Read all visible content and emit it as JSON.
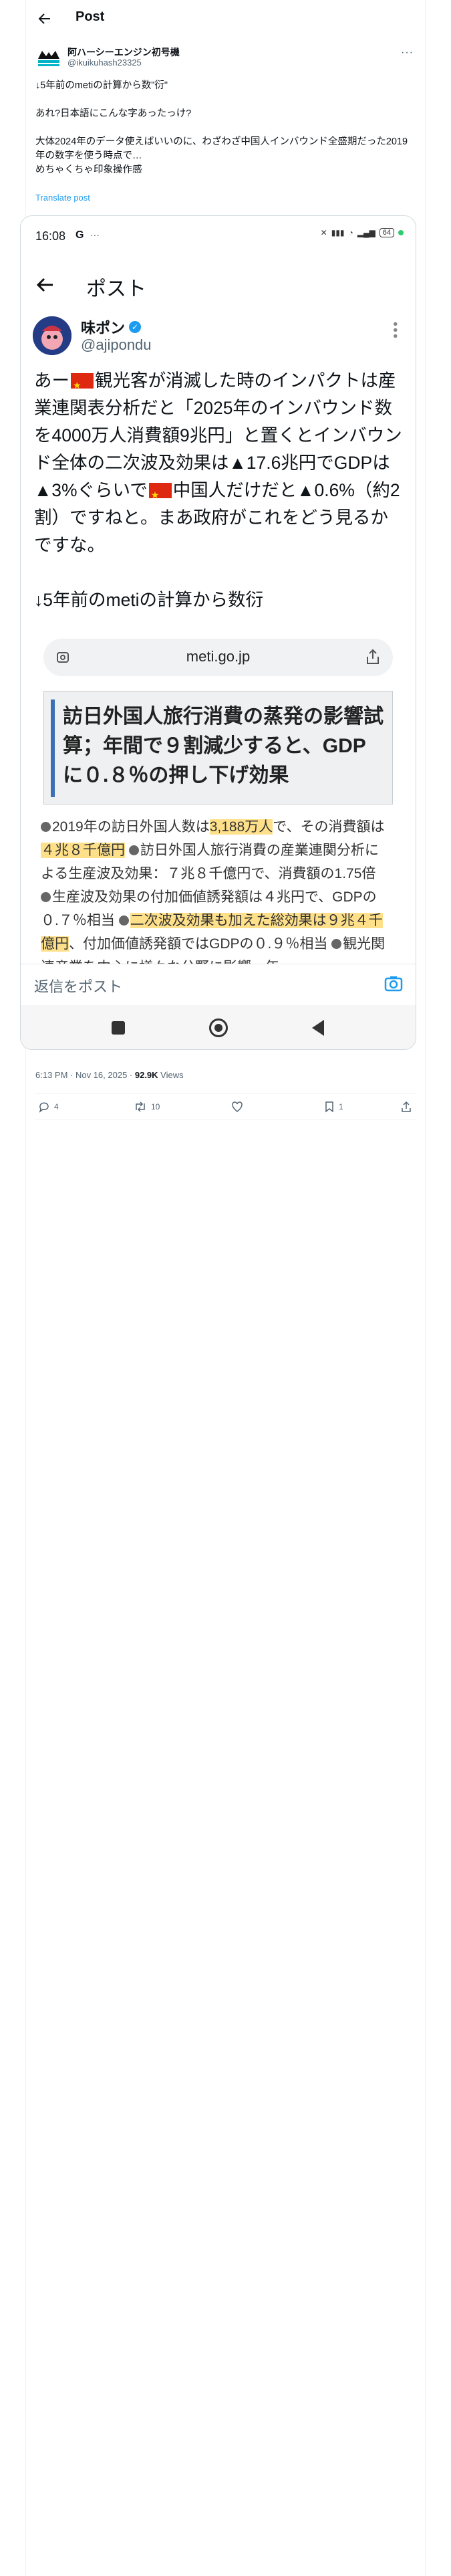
{
  "header": {
    "title": "Post"
  },
  "author": {
    "name": "阿ハーシーエンジン初号機",
    "handle": "@ikuikuhash23325"
  },
  "tweet": {
    "text": "↓5年前のmetiの計算から数\"衍\"\n\nあれ?日本語にこんな字あったっけ?\n\n大体2024年のデータ使えばいいのに、わざわざ中国人インバウンド全盛期だった2019年の数字を使う時点で…\nめちゃくちゃ印象操作感",
    "translate": "Translate post"
  },
  "embedded": {
    "status": {
      "time": "16:08",
      "g": "G",
      "dots": "···",
      "battery": "64"
    },
    "appbar_title": "ポスト",
    "author_name": "味ポン",
    "author_handle": "@ajipondu",
    "text_parts": {
      "p1": "あー",
      "p2": "観光客が消滅した時のインパクトは産業連関表分析だと「2025年のインバウンド数を4000万人消費額9兆円」と置くとインバウンド全体の二次波及効果は▲17.6兆円でGDPは▲3%ぐらいで",
      "p3": "中国人だけだと▲0.6%（約2割）ですねと。まあ政府がこれをどう見るかですな。",
      "p4": "↓5年前のmetiの計算から数衍"
    },
    "url": "meti.go.jp",
    "headline": "訪日外国人旅行消費の蒸発の影響試算；年間で９割減少すると、GDPに０.８％の押し下げ効果",
    "doc": {
      "s1": "2019年の訪日外国人数は",
      "h1": "3,188万人",
      "s2": "で、その消費額は",
      "h2": "４兆８千億円",
      "s3": "訪日外国人旅行消費の産業連関分析による生産波及効果：７兆８千億円で、消費額の1.75倍",
      "s4": "生産波及効果の付加価値誘発額は４兆円で、GDPの０.７％相当",
      "h3": "二次波及効果も加えた総効果は９兆４千億円",
      "s5": "、付加価値誘発額ではGDPの０.９％相当",
      "s6": "観光関連産業を中心に様々な分野に影響、年"
    },
    "reply_placeholder": "返信をポスト"
  },
  "meta": {
    "time": "6:13 PM · Nov 16, 2025 · ",
    "views": "92.9K",
    "views_label": " Views"
  },
  "actions": {
    "replies": "4",
    "reposts": "10",
    "likes": "",
    "bookmarks": "1"
  },
  "colors": {
    "accent": "#1d9bf0",
    "highlight": "#ffe08a",
    "headline_bar": "#3b6fb6"
  }
}
